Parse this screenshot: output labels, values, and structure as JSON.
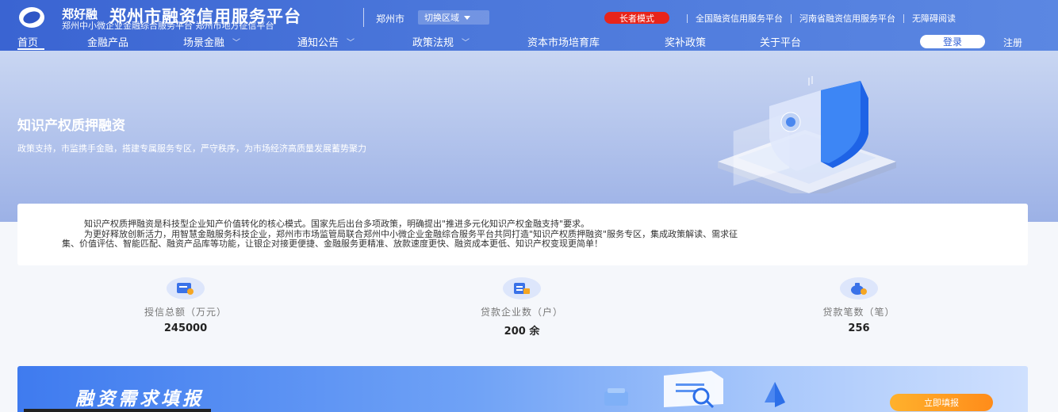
{
  "header": {
    "brand": "郑好融",
    "title": "郑州市融资信用服务平台",
    "subtitle": "郑州中小微企业金融综合服务平台 郑州市地方征信平台",
    "city": "郑州市",
    "switch_region": "切换区域",
    "elder_mode": "长者模式",
    "links": [
      "全国融资信用服务平台",
      "河南省融资信用服务平台",
      "无障碍阅读"
    ],
    "login": "登录",
    "register": "注册"
  },
  "nav": {
    "items": [
      {
        "label": "首页",
        "chevron": ""
      },
      {
        "label": "金融产品",
        "chevron": ""
      },
      {
        "label": "场景金融",
        "chevron": "﹀"
      },
      {
        "label": "通知公告",
        "chevron": "﹀"
      },
      {
        "label": "政策法规",
        "chevron": "﹀"
      },
      {
        "label": "资本市场培育库",
        "chevron": ""
      },
      {
        "label": "奖补政策",
        "chevron": ""
      },
      {
        "label": "关于平台",
        "chevron": ""
      }
    ]
  },
  "banner": {
    "title": "知识产权质押融资",
    "subtitle": "政策支持，市监携手金融，搭建专属服务专区，严守秩序，为市场经济高质量发展蓄势聚力"
  },
  "intro": {
    "line1": "知识产权质押融资是科技型企业知产价值转化的核心模式。国家先后出台多项政策，明确提出\"推进多元化知识产权金融支持\"要求。",
    "line2": "为更好释放创新活力，用智慧金融服务科技企业，郑州市市场监管局联合郑州中小微企业金融综合服务平台共同打造\"知识产权质押融资\"服务专区，集成政策解读、需求征",
    "line3": "集、价值评估、智能匹配、融资产品库等功能，让银企对接更便捷、金融服务更精准、放款速度更快、融资成本更低、知识产权变现更简单！"
  },
  "stats": [
    {
      "label": "授信总额（万元）",
      "value": "245000",
      "icon": "credit-card-icon"
    },
    {
      "label": "贷款企业数（户）",
      "value": "200 余",
      "icon": "enterprise-icon"
    },
    {
      "label": "贷款笔数（笔）",
      "value": "256",
      "icon": "money-bag-icon"
    }
  ],
  "demand": {
    "title": "融资需求填报",
    "button": "立即填报"
  },
  "colors": {
    "header": "#3a64d2",
    "elder_badge": "#e8241a",
    "accent_orange": "#ff9a1f",
    "login_text": "#2f5fd6"
  }
}
